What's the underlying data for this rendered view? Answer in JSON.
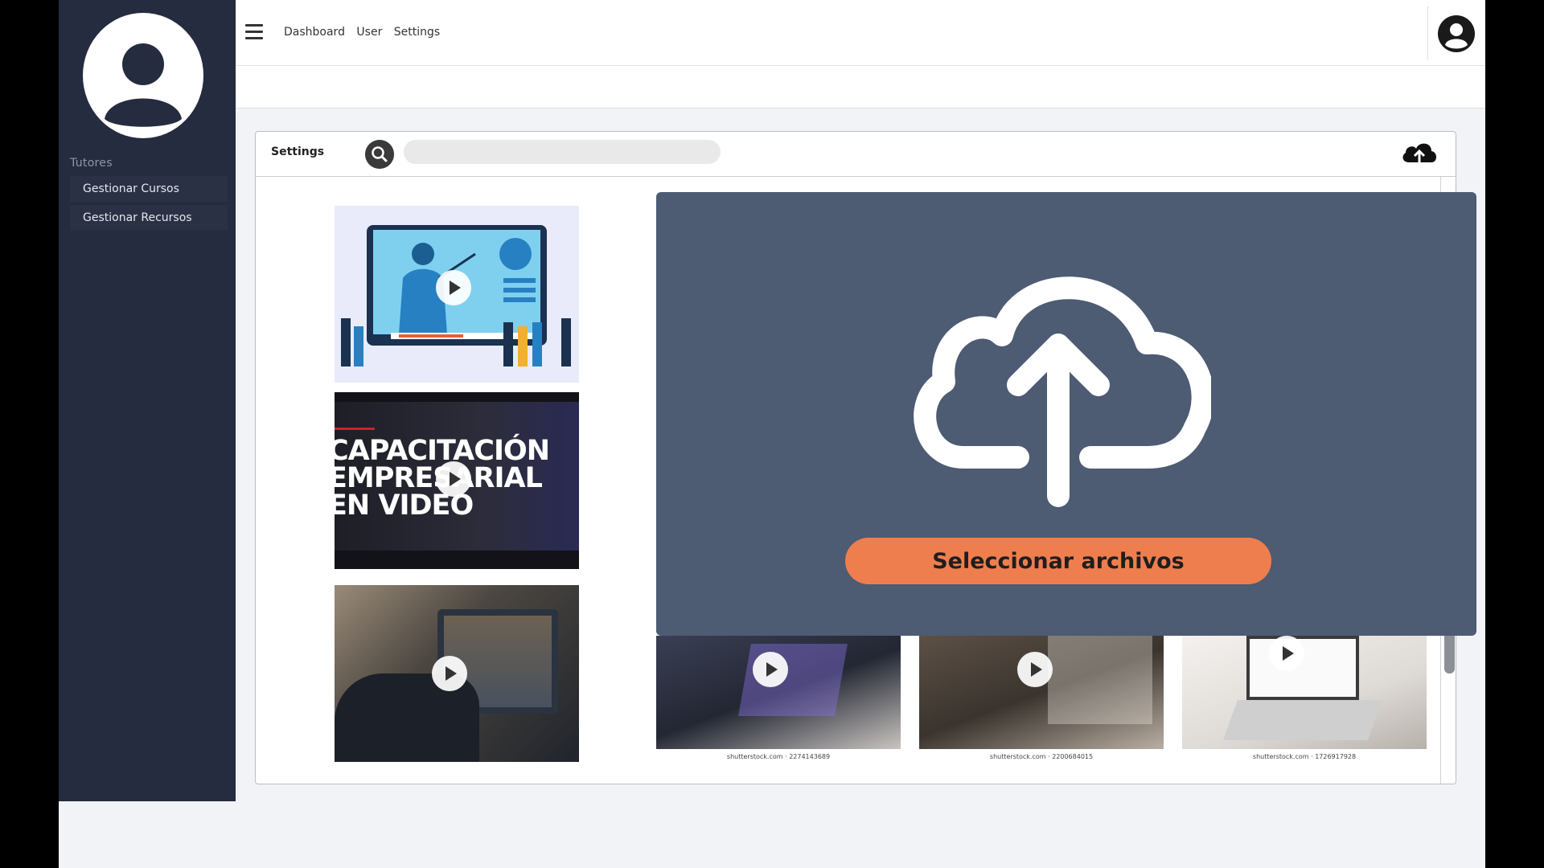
{
  "sidebar": {
    "section_title": "Tutores",
    "items": [
      {
        "label": "Gestionar Cursos"
      },
      {
        "label": "Gestionar Recursos"
      }
    ]
  },
  "topbar": {
    "nav": [
      "Dashboard",
      "User",
      "Settings"
    ]
  },
  "card": {
    "title": "Settings",
    "search_placeholder": ""
  },
  "thumbnails": [
    {
      "name": "video-illustration-thumbnail"
    },
    {
      "name": "capacitacion-video-thumbnail",
      "overlay_text": "CAPACITACIÓN\nEMPRESARIAL\nEN VIDEO"
    },
    {
      "name": "video-call-thumbnail"
    },
    {
      "name": "laptop-thumbnail-1",
      "caption": "shutterstock.com · 2274143689"
    },
    {
      "name": "laptop-thumbnail-2",
      "caption": "shutterstock.com · 2200684015"
    },
    {
      "name": "laptop-thumbnail-3",
      "caption": "shutterstock.com · 1726917928"
    }
  ],
  "modal": {
    "select_button_label": "Seleccionar archivos"
  },
  "colors": {
    "sidebar_bg": "#262c3f",
    "modal_bg": "#4d5b73",
    "accent_orange": "#ef7e4e"
  },
  "icons": [
    "hamburger-icon",
    "avatar-icon",
    "search-icon",
    "cloud-upload-icon",
    "play-icon"
  ]
}
